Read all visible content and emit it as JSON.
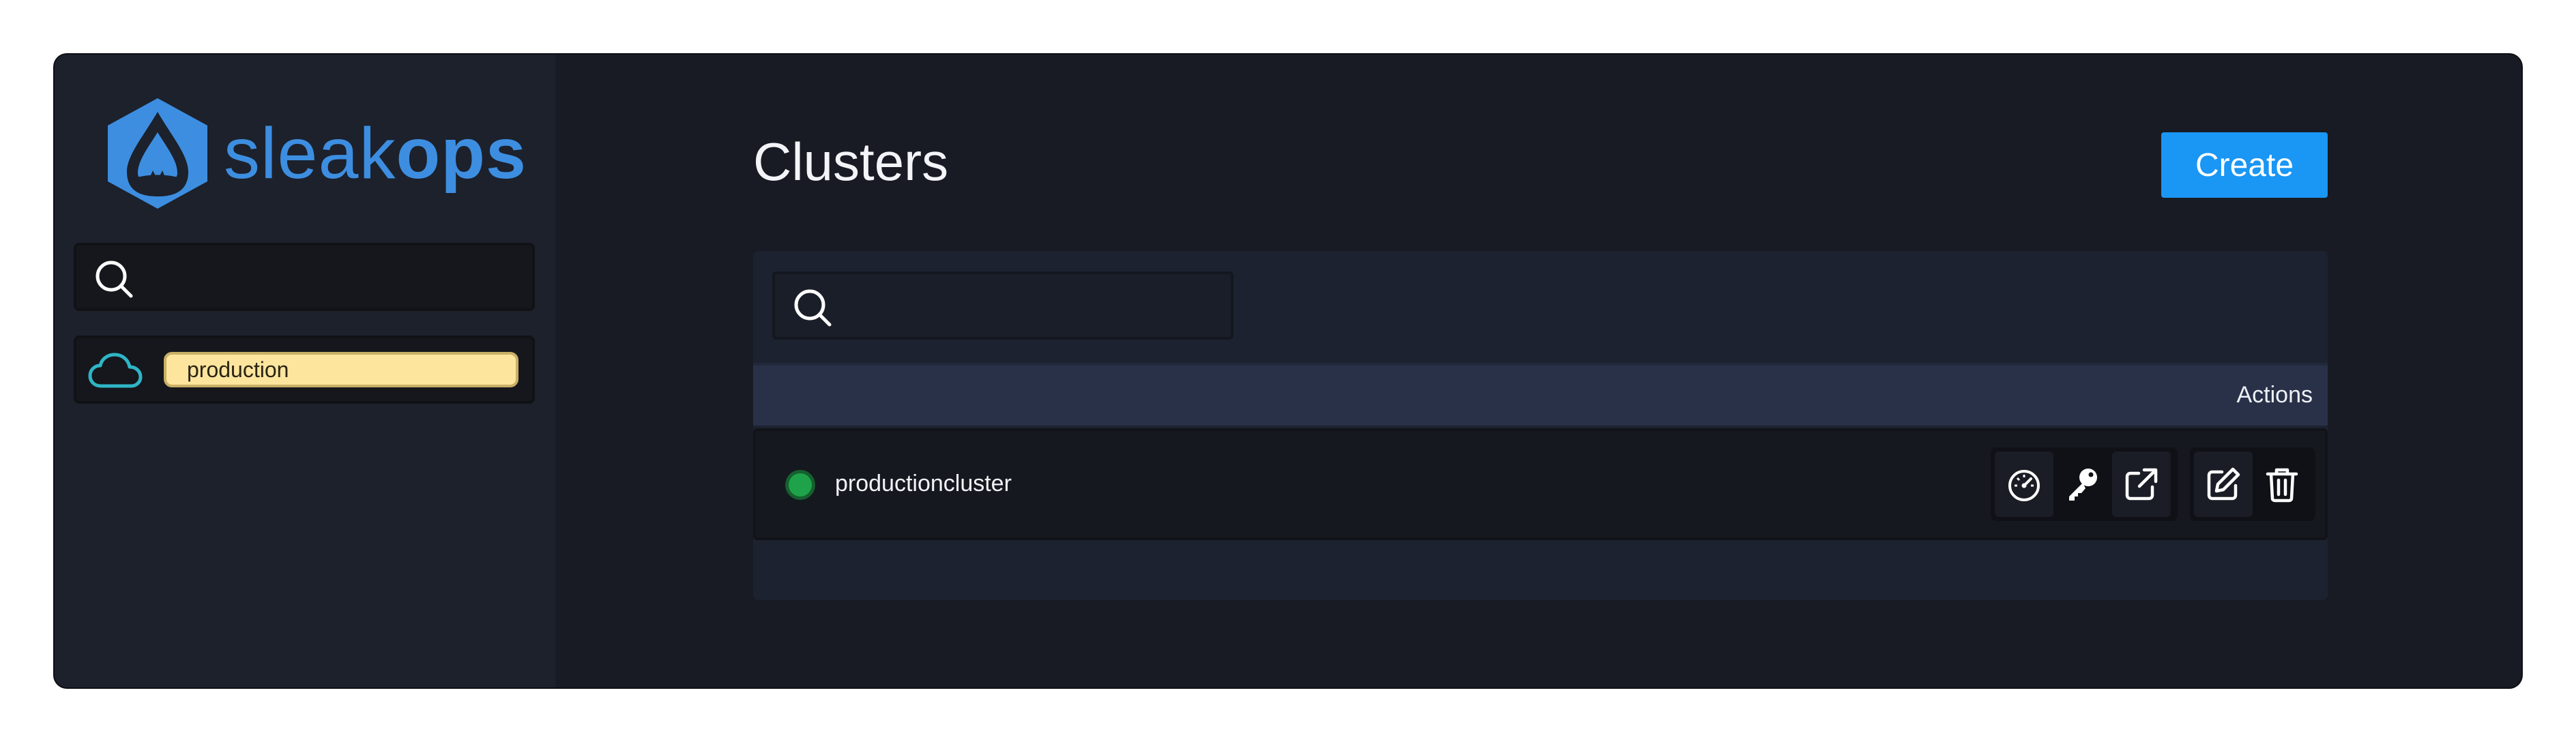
{
  "brand": {
    "name_light": "sleak",
    "name_bold": "ops",
    "color": "#3d8ee0"
  },
  "sidebar": {
    "search_icon": "search-icon",
    "environments": [
      {
        "icon": "cloud-icon",
        "label": "production"
      }
    ]
  },
  "main": {
    "title": "Clusters",
    "create_label": "Create",
    "table": {
      "search_icon": "search-icon",
      "columns": [
        "Actions"
      ],
      "rows": [
        {
          "status": "running",
          "status_color": "#1fa34a",
          "name": "productioncluster",
          "actions": [
            "dashboard-gauge-icon",
            "key-icon",
            "external-link-icon",
            "edit-icon",
            "trash-icon"
          ]
        }
      ]
    }
  },
  "colors": {
    "accent": "#1a96f5",
    "background": "#181b23",
    "sidebar": "#1c212c",
    "env_chip": "#fde59e"
  }
}
